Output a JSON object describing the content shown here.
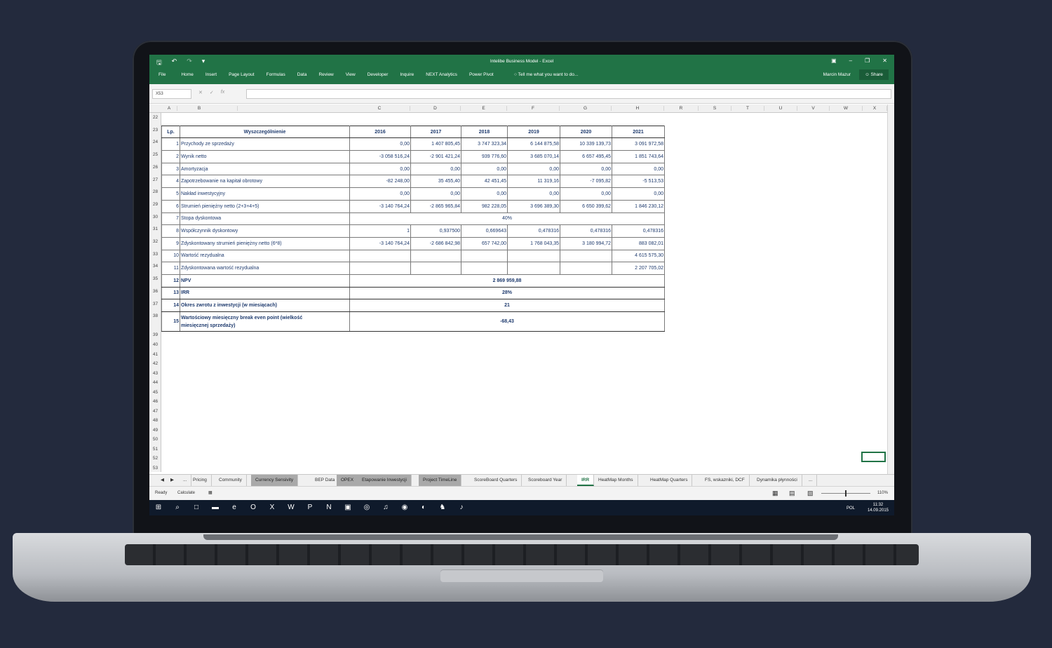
{
  "window": {
    "title": "Intelibe Business Model - Excel",
    "user": "Marcin Mazur",
    "share": "Share",
    "tell_me": "Tell me what you want to do..."
  },
  "menu": [
    "File",
    "Home",
    "Insert",
    "Page Layout",
    "Formulas",
    "Data",
    "Review",
    "View",
    "Developer",
    "Inquire",
    "NEXT Analytics",
    "Power Pivot"
  ],
  "formula_bar": {
    "name_box": "X53",
    "formula": ""
  },
  "columns": [
    "A",
    "B",
    "C",
    "D",
    "E",
    "F",
    "G",
    "H",
    "R",
    "S",
    "T",
    "U",
    "V",
    "W",
    "X"
  ],
  "rows": [
    "22",
    "23",
    "24",
    "25",
    "26",
    "27",
    "28",
    "29",
    "30",
    "31",
    "32",
    "33",
    "34",
    "35",
    "36",
    "37",
    "38",
    "39",
    "40",
    "41",
    "42",
    "43",
    "44",
    "45",
    "46",
    "47",
    "48",
    "49",
    "50",
    "51",
    "52",
    "53",
    "54"
  ],
  "table": {
    "header": [
      "Lp.",
      "Wyszczególnienie",
      "2016",
      "2017",
      "2018",
      "2019",
      "2020",
      "2021"
    ],
    "data_rows": [
      [
        "1",
        "Przychody ze sprzedaży",
        "0,00",
        "1 407 805,45",
        "3 747 323,34",
        "6 144 875,58",
        "10 339 139,73",
        "3 091 972,58"
      ],
      [
        "2",
        "Wynik netto",
        "-3 058 516,24",
        "-2 901 421,24",
        "939 776,60",
        "3 685 070,14",
        "6 657 495,45",
        "1 851 743,64"
      ],
      [
        "3",
        "Amortyzacja",
        "0,00",
        "0,00",
        "0,00",
        "0,00",
        "0,00",
        "0,00"
      ],
      [
        "4",
        "Zapotrzebowanie na kapitał obrotowy",
        "-82 248,00",
        "35 455,40",
        "42 451,45",
        "11 319,16",
        "-7 095,82",
        "-5 513,53"
      ],
      [
        "5",
        "Nakład inwestycyjny",
        "0,00",
        "0,00",
        "0,00",
        "0,00",
        "0,00",
        "0,00"
      ],
      [
        "6",
        "Strumień pieniężny netto (2+3+4+5)",
        "-3 140 764,24",
        "-2 865 965,84",
        "982 228,05",
        "3 696 389,30",
        "6 650 399,62",
        "1 846 230,12"
      ]
    ],
    "discount_row": {
      "lp": "7",
      "label": "Stopa dyskontowa",
      "value": "40%"
    },
    "data_rows2": [
      [
        "8",
        "Współczynnik dyskontowy",
        "1",
        "0,937500",
        "0,669643",
        "0,478316",
        "0,478316",
        "0,478316"
      ],
      [
        "9",
        "Zdyskontowany strumień pieniężny netto (6*8)",
        "-3 140 764,24",
        "-2 686 842,98",
        "657 742,00",
        "1 768 043,35",
        "3 180 994,72",
        "883 082,01"
      ],
      [
        "10",
        "Wartość rezydualna",
        "",
        "",
        "",
        "",
        "",
        "4 615 575,30"
      ],
      [
        "11",
        "Zdyskontowana wartość rezydualna",
        "",
        "",
        "",
        "",
        "",
        "2 207 705,02"
      ]
    ],
    "summary_rows": [
      {
        "lp": "12",
        "label": "NPV",
        "value": "2 869 959,88"
      },
      {
        "lp": "13",
        "label": "IRR",
        "value": "28%"
      },
      {
        "lp": "14",
        "label": "Okres zwrotu z inwestycji (w miesiącach)",
        "value": "21"
      }
    ],
    "last_row": {
      "lp": "15",
      "label1": "Wartościowy miesięczny break even point (wielkość",
      "label2": "miesięcznej sprzedaży)",
      "value": "-68,43"
    }
  },
  "sheet_tabs": [
    "...",
    "Pricing",
    "Community",
    "Currency Sensivity",
    "BEP Data",
    "OPEX",
    "Etapowanie Inwestycji",
    "Project TimeLine",
    "ScoreBoard Quarters",
    "Scoreboard Year",
    "IRR",
    "HeatMap Months",
    "HeatMap Quarters",
    "FS, wskazniki, DCF",
    "Dynamika płynności",
    "..."
  ],
  "status": {
    "ready": "Ready",
    "calculate": "Calculate",
    "zoom": "110%"
  },
  "tray": {
    "lang": "POL",
    "time": "11:32",
    "date": "14.09.2015"
  }
}
